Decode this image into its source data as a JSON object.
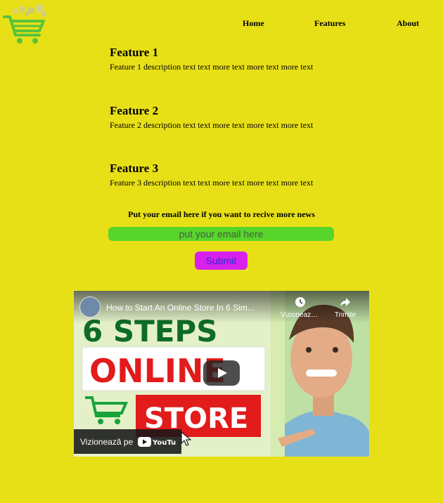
{
  "nav": {
    "home": "Home",
    "features": "Features",
    "about": "About"
  },
  "features": [
    {
      "title": "Feature 1",
      "description": "Feature 1 description text text more text more text more text"
    },
    {
      "title": "Feature 2",
      "description": "Feature 2 description text text more text more text more text"
    },
    {
      "title": "Feature 3",
      "description": "Feature 3 description text text more text more text more text"
    }
  ],
  "newsletter": {
    "label": "Put your email here if you want to recive more news",
    "placeholder": "put your email here",
    "submit": "Submit"
  },
  "video": {
    "title": "How to Start An Online Store In 6 Sim...",
    "watch_later": "Vizionează...",
    "share": "Trimite",
    "watch_on": "Vizionează pe",
    "youtube": "YouTube",
    "thumb_line1": "6 STEPS",
    "thumb_line2": "ONLINE",
    "thumb_line3": "STORE"
  },
  "colors": {
    "page_bg": "#e8e017",
    "email_bg": "#58d52b",
    "submit_bg": "#d821ec",
    "submit_text": "#2b2bd6"
  }
}
